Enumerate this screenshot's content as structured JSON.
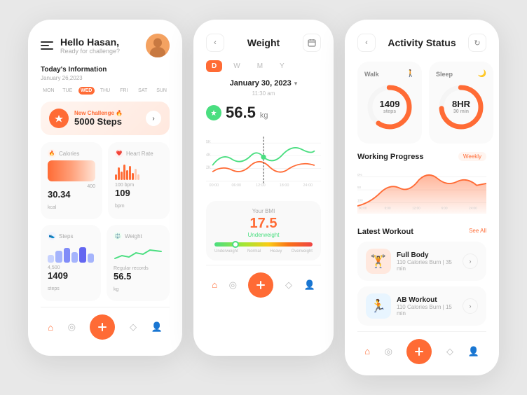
{
  "card1": {
    "greeting": "Hello Hasan,",
    "subgreeting": "Ready for challenge?",
    "today_label": "Today's Information",
    "date": "January 26,2023",
    "days": [
      "MON",
      "TUE",
      "WED",
      "THU",
      "FRI",
      "SAT",
      "SUN"
    ],
    "active_day": "WED",
    "challenge_label": "New Challenge 🔥",
    "challenge_steps": "5000 Steps",
    "calories_label": "Calories",
    "calories_value": "30.34",
    "calories_unit": "kcal",
    "heartrate_label": "Heart Rate",
    "heartrate_value": "109",
    "heartrate_unit": "bpm",
    "steps_label": "Steps",
    "steps_value": "1409",
    "steps_unit": "steps",
    "weight_label": "Weight",
    "weight_value": "56.5",
    "weight_unit": "kg",
    "weight_note": "Regular records"
  },
  "card2": {
    "title": "Weight",
    "tabs": [
      "D",
      "W",
      "M",
      "Y"
    ],
    "active_tab": "D",
    "date": "January 30, 2023",
    "time": "11:30 am",
    "weight_value": "56.5",
    "weight_unit": "kg",
    "bmi_label": "Your BMI",
    "bmi_value": "17.5",
    "bmi_status": "Underweight",
    "bmi_range_labels": [
      "Underweight",
      "Normal",
      "Heavy",
      "Overweight"
    ]
  },
  "card3": {
    "title": "Activity Status",
    "walk_label": "Walk",
    "walk_value": "1409",
    "walk_unit": "steps",
    "sleep_label": "Sleep",
    "sleep_value": "8HR",
    "sleep_unit": "30 min",
    "working_progress": "Working Progress",
    "filter": "Weekly",
    "latest_workout": "Latest Workout",
    "see_all": "See All",
    "workouts": [
      {
        "name": "Full Body",
        "cals": "110 Calories Burn | 35 min",
        "emoji": "🏋️"
      },
      {
        "name": "AB Workout",
        "cals": "110 Calories Burn | 15 min",
        "emoji": "🏃"
      }
    ]
  },
  "colors": {
    "accent": "#ff6b35",
    "success": "#4ade80",
    "bg": "#e8e8e8",
    "card": "#ffffff"
  }
}
